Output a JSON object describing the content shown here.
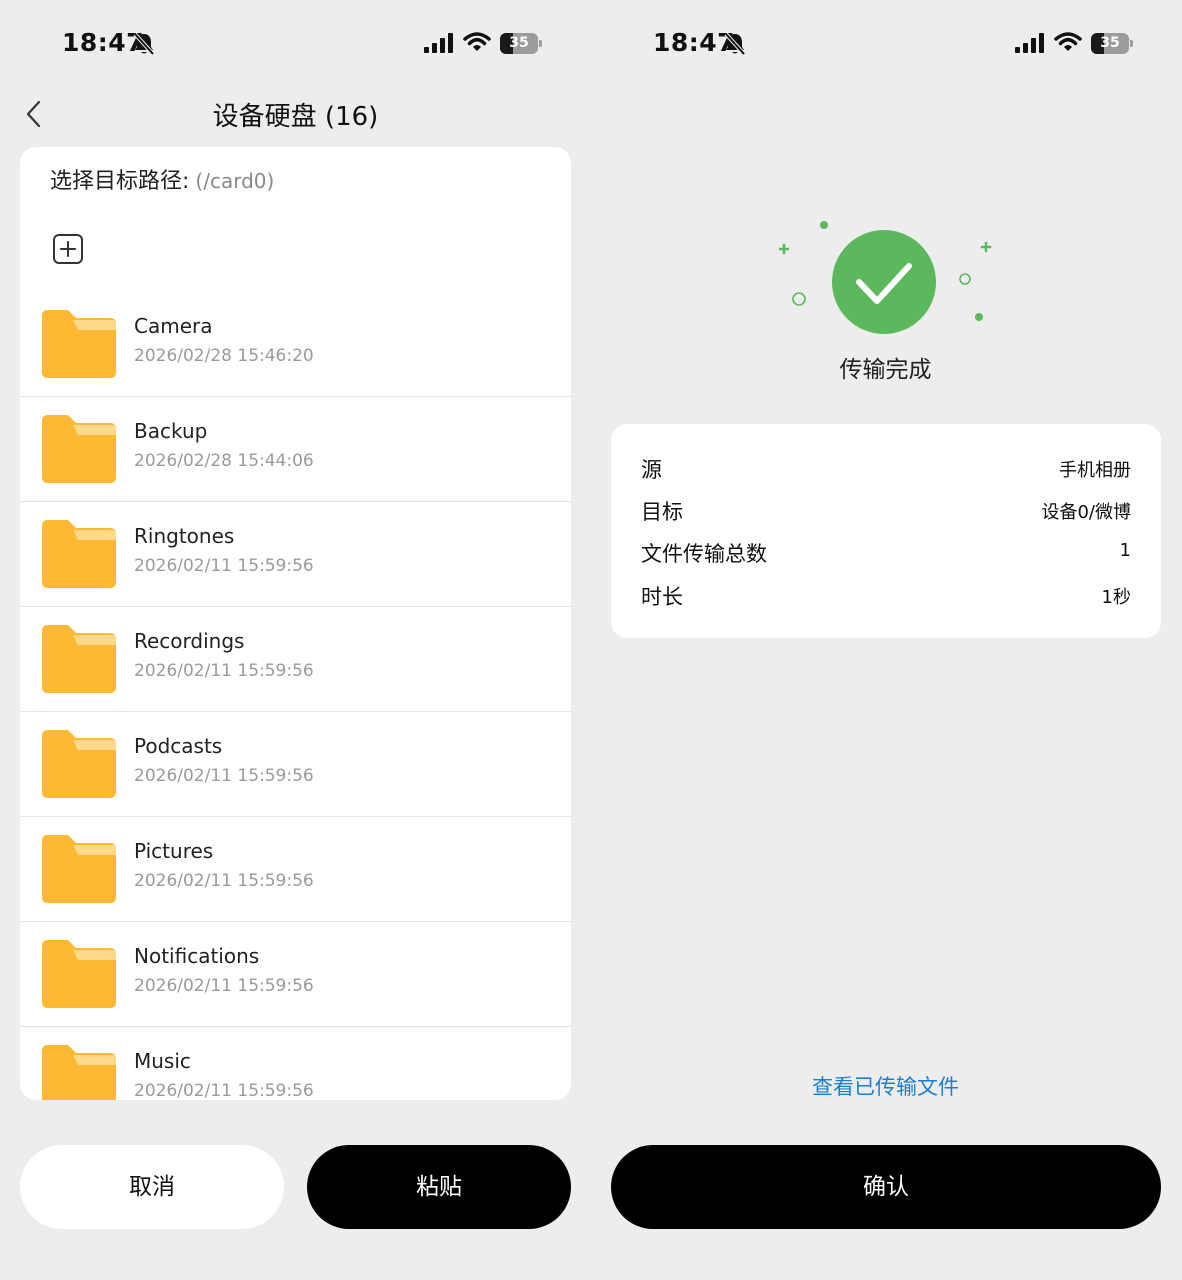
{
  "status_bar": {
    "time": "18:47",
    "battery": "35",
    "battery_level": 0.35
  },
  "left": {
    "title": "设备硬盘 (16)",
    "target_path_label": "选择目标路径:",
    "target_path_value": "(/card0)",
    "folders": [
      {
        "name": "Camera",
        "date": "2026/02/28 15:46:20"
      },
      {
        "name": "Backup",
        "date": "2026/02/28 15:44:06"
      },
      {
        "name": "Ringtones",
        "date": "2026/02/11 15:59:56"
      },
      {
        "name": "Recordings",
        "date": "2026/02/11 15:59:56"
      },
      {
        "name": "Podcasts",
        "date": "2026/02/11 15:59:56"
      },
      {
        "name": "Pictures",
        "date": "2026/02/11 15:59:56"
      },
      {
        "name": "Notifications",
        "date": "2026/02/11 15:59:56"
      },
      {
        "name": "Music",
        "date": "2026/02/11 15:59:56"
      }
    ],
    "cancel_label": "取消",
    "paste_label": "粘贴"
  },
  "right": {
    "success_title": "传输完成",
    "details": [
      {
        "label": "源",
        "value": "手机相册"
      },
      {
        "label": "目标",
        "value": "设备0/微博"
      },
      {
        "label": "文件传输总数",
        "value": "1"
      },
      {
        "label": "时长",
        "value": "1秒"
      }
    ],
    "view_files_link": "查看已传输文件",
    "confirm_label": "确认"
  },
  "colors": {
    "folder": "#ffb833",
    "folder_tab": "#ffd98a",
    "success": "#5cb85c",
    "link": "#1a7fd4",
    "background": "#ededed"
  },
  "icons": [
    "bell-off-icon",
    "signal-icon",
    "wifi-icon",
    "battery-icon",
    "back-arrow-icon",
    "add-folder-icon",
    "folder-icon",
    "check-circle-icon"
  ]
}
